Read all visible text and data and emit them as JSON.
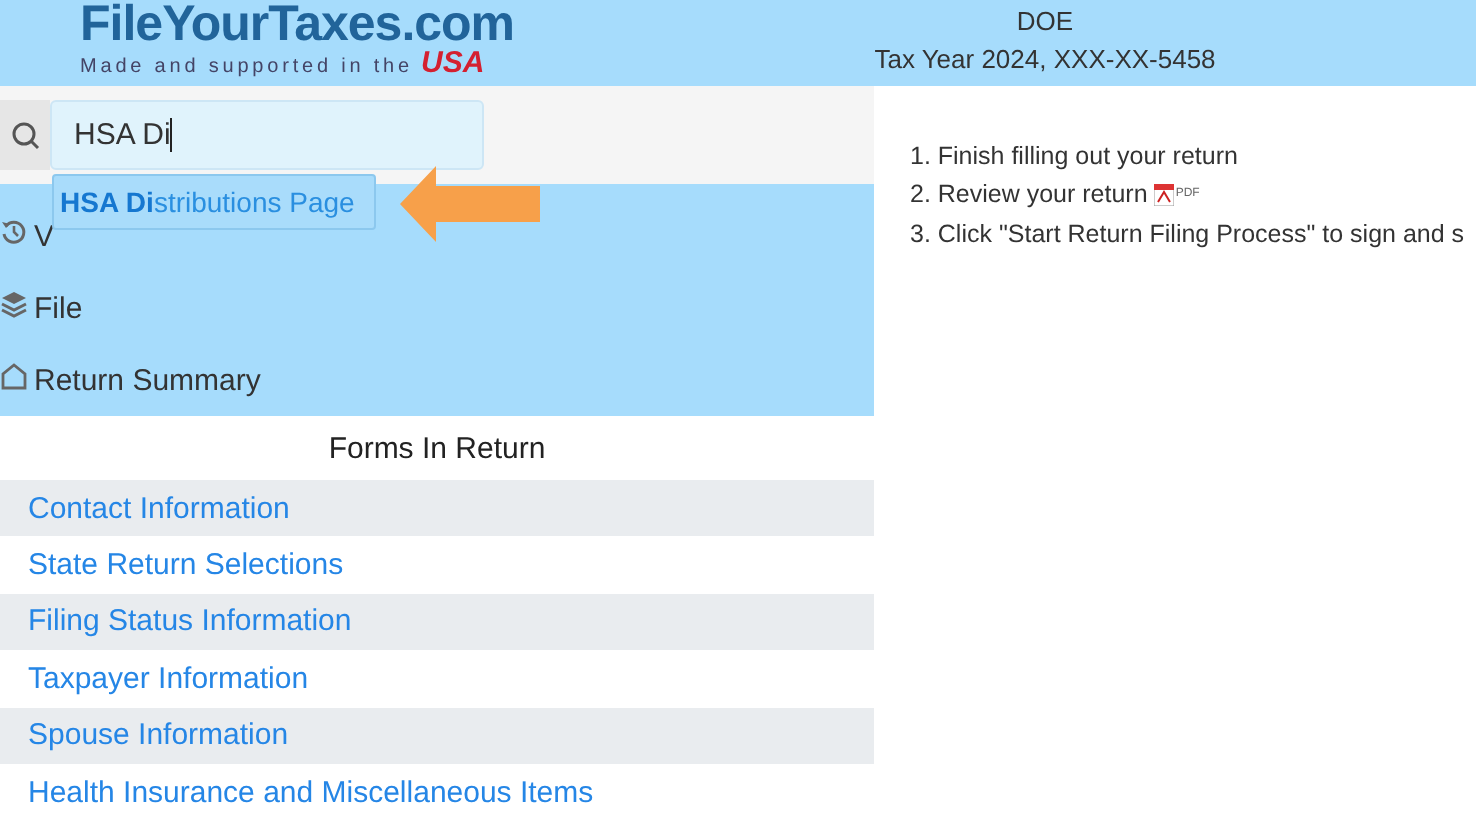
{
  "header": {
    "logo": "FileYourTaxes.com",
    "tagline": "Made and supported in the",
    "tagline_country": "USA",
    "taxpayer_name": "DOE",
    "tax_year": "Tax Year 2024, XXX-XX-5458"
  },
  "search": {
    "value": "HSA Di",
    "suggestion": "**HSA Di**stributions Page"
  },
  "nav_items": [
    {
      "label": "V"
    },
    {
      "label": "File"
    },
    {
      "label": "Return Summary"
    }
  ],
  "forms_heading": "Forms In Return",
  "forms": [
    "Contact Information",
    "State Return Selections",
    "Filing Status Information",
    "Taxpayer Information",
    "Spouse Information",
    "Health Insurance and Miscellaneous Items"
  ],
  "steps": [
    {
      "number": "1.",
      "text": "Finish filling out your return"
    },
    {
      "number": "2.",
      "text": "Review your return",
      "pdf_label": "PDF"
    },
    {
      "number": "3.",
      "text": "Click \"Start Return Filing Process\" to sign and s"
    }
  ]
}
